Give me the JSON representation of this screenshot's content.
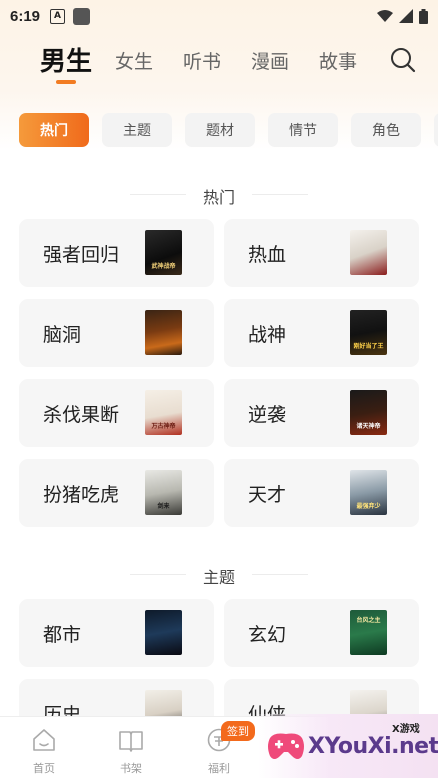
{
  "status_bar": {
    "time": "6:19",
    "app_icon_letter": "A"
  },
  "top_tabs": [
    {
      "label": "男生",
      "active": true
    },
    {
      "label": "女生",
      "active": false
    },
    {
      "label": "听书",
      "active": false
    },
    {
      "label": "漫画",
      "active": false
    },
    {
      "label": "故事",
      "active": false
    }
  ],
  "categories": [
    {
      "label": "热门",
      "active": true
    },
    {
      "label": "主题",
      "active": false
    },
    {
      "label": "题材",
      "active": false
    },
    {
      "label": "情节",
      "active": false
    },
    {
      "label": "角色",
      "active": false
    }
  ],
  "sections": [
    {
      "title": "热门",
      "items": [
        {
          "label": "强者回归",
          "cover_text": "武神战帝"
        },
        {
          "label": "热血",
          "cover_text": ""
        },
        {
          "label": "脑洞",
          "cover_text": ""
        },
        {
          "label": "战神",
          "cover_text": "刚好当了王"
        },
        {
          "label": "杀伐果断",
          "cover_text": "万古神帝"
        },
        {
          "label": "逆袭",
          "cover_text": "诸天神帝"
        },
        {
          "label": "扮猪吃虎",
          "cover_text": "剑来"
        },
        {
          "label": "天才",
          "cover_text": "最强弃少"
        }
      ]
    },
    {
      "title": "主题",
      "items": [
        {
          "label": "都市",
          "cover_text": ""
        },
        {
          "label": "玄幻",
          "cover_text": "台风之主"
        },
        {
          "label": "历史",
          "cover_text": ""
        },
        {
          "label": "仙侠",
          "cover_text": ""
        }
      ]
    }
  ],
  "bottom_nav": [
    {
      "label": "首页",
      "icon": "home-icon"
    },
    {
      "label": "书架",
      "icon": "bookshelf-icon"
    },
    {
      "label": "福利",
      "icon": "gift-icon"
    }
  ],
  "sign_badge": "签到",
  "ad": {
    "small": "X游戏",
    "main": "XYouXi.net"
  },
  "colors": {
    "accent": "#f27c22",
    "chip_bg": "#f3f3f3",
    "card_bg": "#f6f6f6"
  }
}
